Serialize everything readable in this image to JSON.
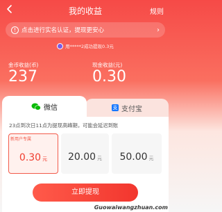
{
  "header": {
    "title": "我的收益",
    "rules_label": "规则"
  },
  "verify_banner": {
    "text": "点击进行实名认证，提现更安心",
    "icon": "info-icon"
  },
  "ticker": {
    "text": "用*****2成功提现0.3元"
  },
  "balances": {
    "coin_label": "金币收益(币)",
    "coin_value": "237",
    "cash_label": "现金收益(元)",
    "cash_value": "0.30"
  },
  "methods": {
    "wechat_label": "微信",
    "alipay_label": "支付宝"
  },
  "notice": "23点到次日11点为提现高峰期，可能会延迟到账",
  "amounts": [
    {
      "badge": "新用户专属",
      "value": "0.30",
      "unit": "元"
    },
    {
      "value": "20.00",
      "unit": "元"
    },
    {
      "value": "50.00",
      "unit": "元"
    }
  ],
  "withdraw_button": "立即提现",
  "watermark": "Guowaiwangzhuan.com",
  "colors": {
    "accent": "#f03c2e",
    "header_red": "#f64a47",
    "wechat_green": "#09bb07",
    "alipay_blue": "#1677ff"
  }
}
